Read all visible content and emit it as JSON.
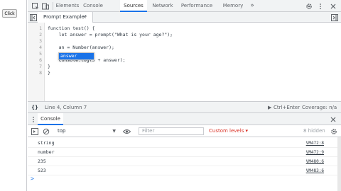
{
  "page": {
    "click_button_label": "Click"
  },
  "devtools": {
    "tabs": [
      {
        "label": "Elements"
      },
      {
        "label": "Console"
      },
      {
        "label": "Sources"
      },
      {
        "label": "Network"
      },
      {
        "label": "Performance"
      },
      {
        "label": "Memory"
      }
    ],
    "more_tabs_label": "»",
    "active_tab": "Sources",
    "file_tab": {
      "label": "Prompt Example*",
      "close": "×"
    },
    "code_lines": [
      {
        "num": "1",
        "text": "function test() {"
      },
      {
        "num": "2",
        "text": "    let answer = prompt(\"What is your age?\");"
      },
      {
        "num": "3",
        "text": ""
      },
      {
        "num": "4",
        "text": "    an = Number(answer);"
      },
      {
        "num": "5",
        "text": ""
      },
      {
        "num": "6",
        "text": "    console.log(5 + answer);"
      },
      {
        "num": "7",
        "text": "}"
      },
      {
        "num": "8",
        "text": "}"
      }
    ],
    "autocomplete": {
      "suggestion": "answer"
    },
    "status": {
      "braces": "{}",
      "position": "Line 4, Column 7",
      "run_hint": "Ctrl+Enter",
      "coverage": "Coverage: n/a"
    }
  },
  "drawer": {
    "tab_label": "Console",
    "close": "×",
    "toolbar": {
      "context": "top",
      "filter_placeholder": "Filter",
      "levels_label": "Custom levels ▾",
      "hidden_count": "8 hidden"
    },
    "messages": [
      {
        "text": "string",
        "source": "VM472:8"
      },
      {
        "text": "number",
        "source": "VM472:9"
      },
      {
        "text": "235",
        "source": "VM480:6"
      },
      {
        "text": "523",
        "source": "VM483:6"
      }
    ],
    "prompt_symbol": ">"
  },
  "colors": {
    "accent": "#1a73e8",
    "toolbar_bg": "#f1f3f4",
    "levels_text": "#d93025"
  }
}
